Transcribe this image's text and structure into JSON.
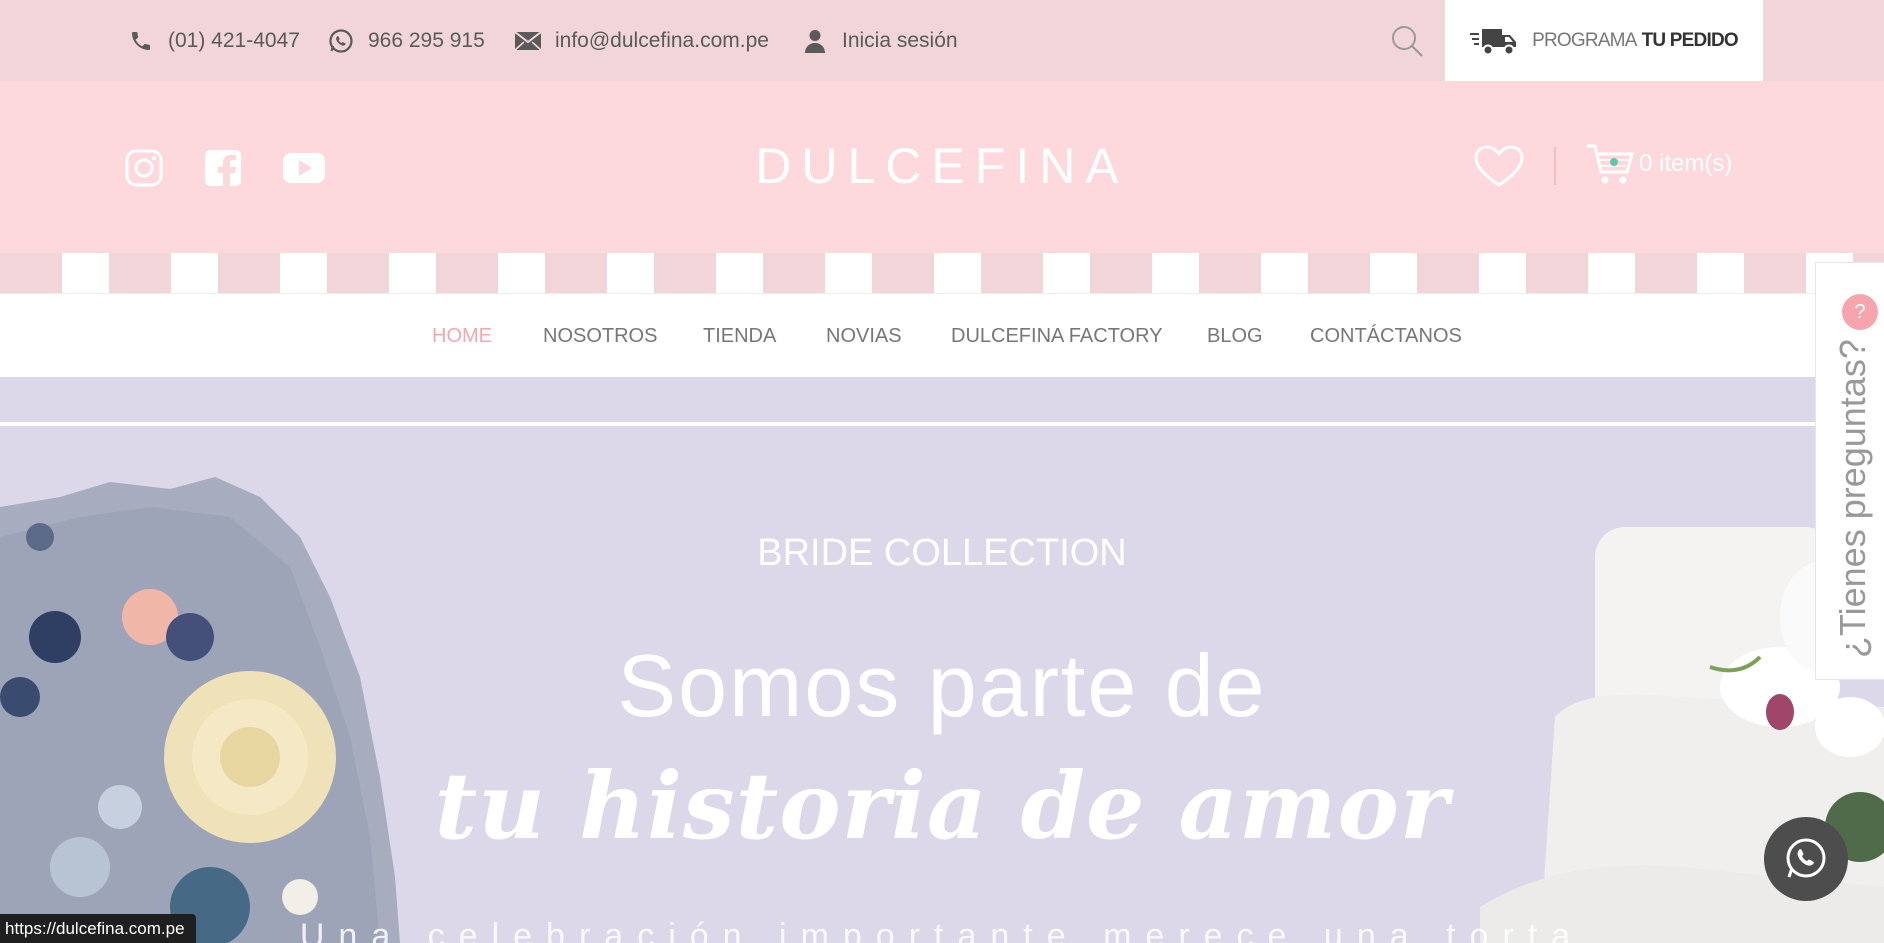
{
  "topbar": {
    "phone": "(01) 421-4047",
    "whatsapp": "966 295 915",
    "email": "info@dulcefina.com.pe",
    "login": "Inicia sesión",
    "order_label_light": "PROGRAMA",
    "order_label_bold": "TU PEDIDO",
    "icons": [
      "phone-icon",
      "whatsapp-icon",
      "mail-icon",
      "user-icon",
      "search-icon",
      "truck-icon"
    ]
  },
  "header": {
    "logo": "DULCEFINA",
    "cart_label": "0 item(s)",
    "social": [
      "instagram-icon",
      "facebook-icon",
      "youtube-icon"
    ]
  },
  "nav": {
    "items": [
      "HOME",
      "NOSOTROS",
      "TIENDA",
      "NOVIAS",
      "DULCEFINA FACTORY",
      "BLOG",
      "CONTÁCTANOS"
    ],
    "active": "HOME"
  },
  "hero": {
    "kicker": "BRIDE COLLECTION",
    "title_line1": "Somos parte de",
    "title_line2": "tu historia de amor",
    "subtitle": "Una celebración importante merece una torta"
  },
  "faq": {
    "badge": "?",
    "label": "¿Tienes preguntas?"
  },
  "status_bar": {
    "url": "https://dulcefina.com.pe"
  },
  "colors": {
    "topbar_bg": "#f2d5d8",
    "header_bg": "#fdd9de",
    "hero_bg": "#dcd8ea",
    "nav_active": "#f3a8b1",
    "faq_badge": "#f6a5ad",
    "whatsapp_float": "#4d4d4d"
  }
}
